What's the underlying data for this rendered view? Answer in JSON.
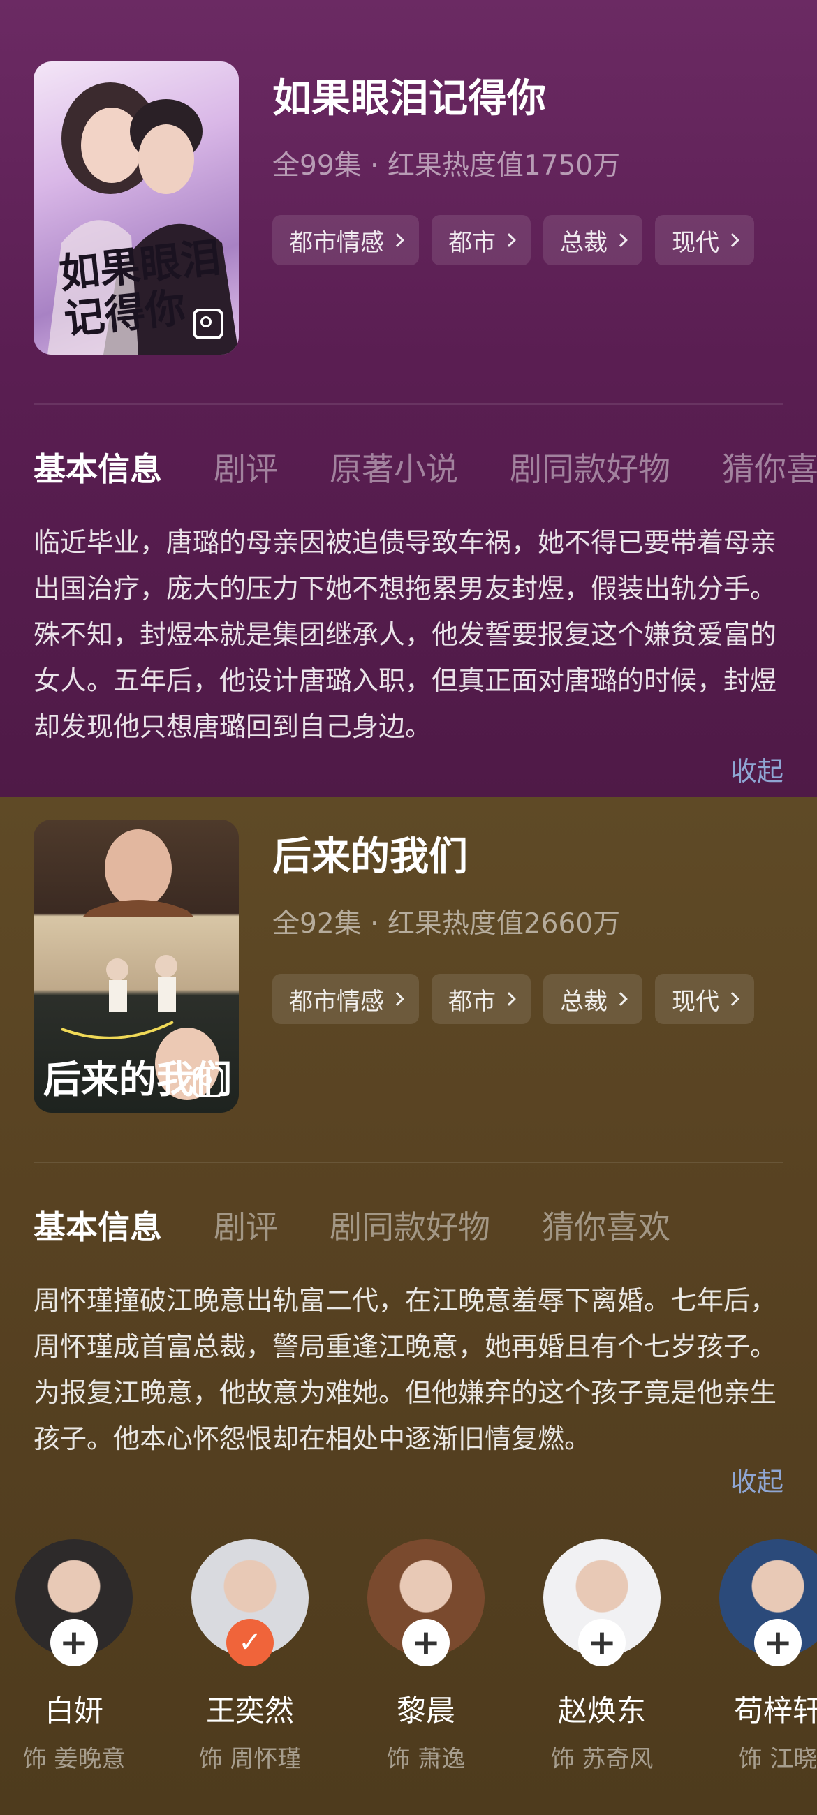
{
  "dramas": [
    {
      "title": "如果眼泪记得你",
      "meta": "全99集 · 红果热度值1750万",
      "poster_text": "如果眼泪记得你",
      "tags": [
        "都市情感",
        "都市",
        "总裁",
        "现代"
      ],
      "tabs": [
        "基本信息",
        "剧评",
        "原著小说",
        "剧同款好物",
        "猜你喜"
      ],
      "synopsis": "临近毕业，唐璐的母亲因被追债导致车祸，她不得已要带着母亲出国治疗，庞大的压力下她不想拖累男友封煜，假装出轨分手。殊不知，封煜本就是集团继承人，他发誓要报复这个嫌贫爱富的女人。五年后，他设计唐璐入职，但真正面对唐璐的时候，封煜却发现他只想唐璐回到自己身边。",
      "collapse": "收起"
    },
    {
      "title": "后来的我们",
      "meta": "全92集 · 红果热度值2660万",
      "poster_text": "后来的我们",
      "tags": [
        "都市情感",
        "都市",
        "总裁",
        "现代"
      ],
      "tabs": [
        "基本信息",
        "剧评",
        "剧同款好物",
        "猜你喜欢"
      ],
      "synopsis": "周怀瑾撞破江晚意出轨富二代，在江晚意羞辱下离婚。七年后，周怀瑾成首富总裁，警局重逢江晚意，她再婚且有个七岁孩子。为报复江晚意，他故意为难她。但他嫌弃的这个孩子竟是他亲生孩子。他本心怀怨恨却在相处中逐渐旧情复燃。",
      "collapse": "收起",
      "cast": [
        {
          "name": "白妍",
          "role": "饰 姜晚意",
          "followed": false,
          "color": "#2d2a2a"
        },
        {
          "name": "王奕然",
          "role": "饰 周怀瑾",
          "followed": true,
          "color": "#d9dadf"
        },
        {
          "name": "黎晨",
          "role": "饰 萧逸",
          "followed": false,
          "color": "#7a4a2e"
        },
        {
          "name": "赵焕东",
          "role": "饰 苏奇风",
          "followed": false,
          "color": "#f1f1f3"
        },
        {
          "name": "苟梓轩",
          "role": "饰 江晓",
          "followed": false,
          "color": "#2b4a7a"
        }
      ]
    }
  ],
  "icons": {
    "follow_add": "+",
    "follow_done": "✓"
  }
}
